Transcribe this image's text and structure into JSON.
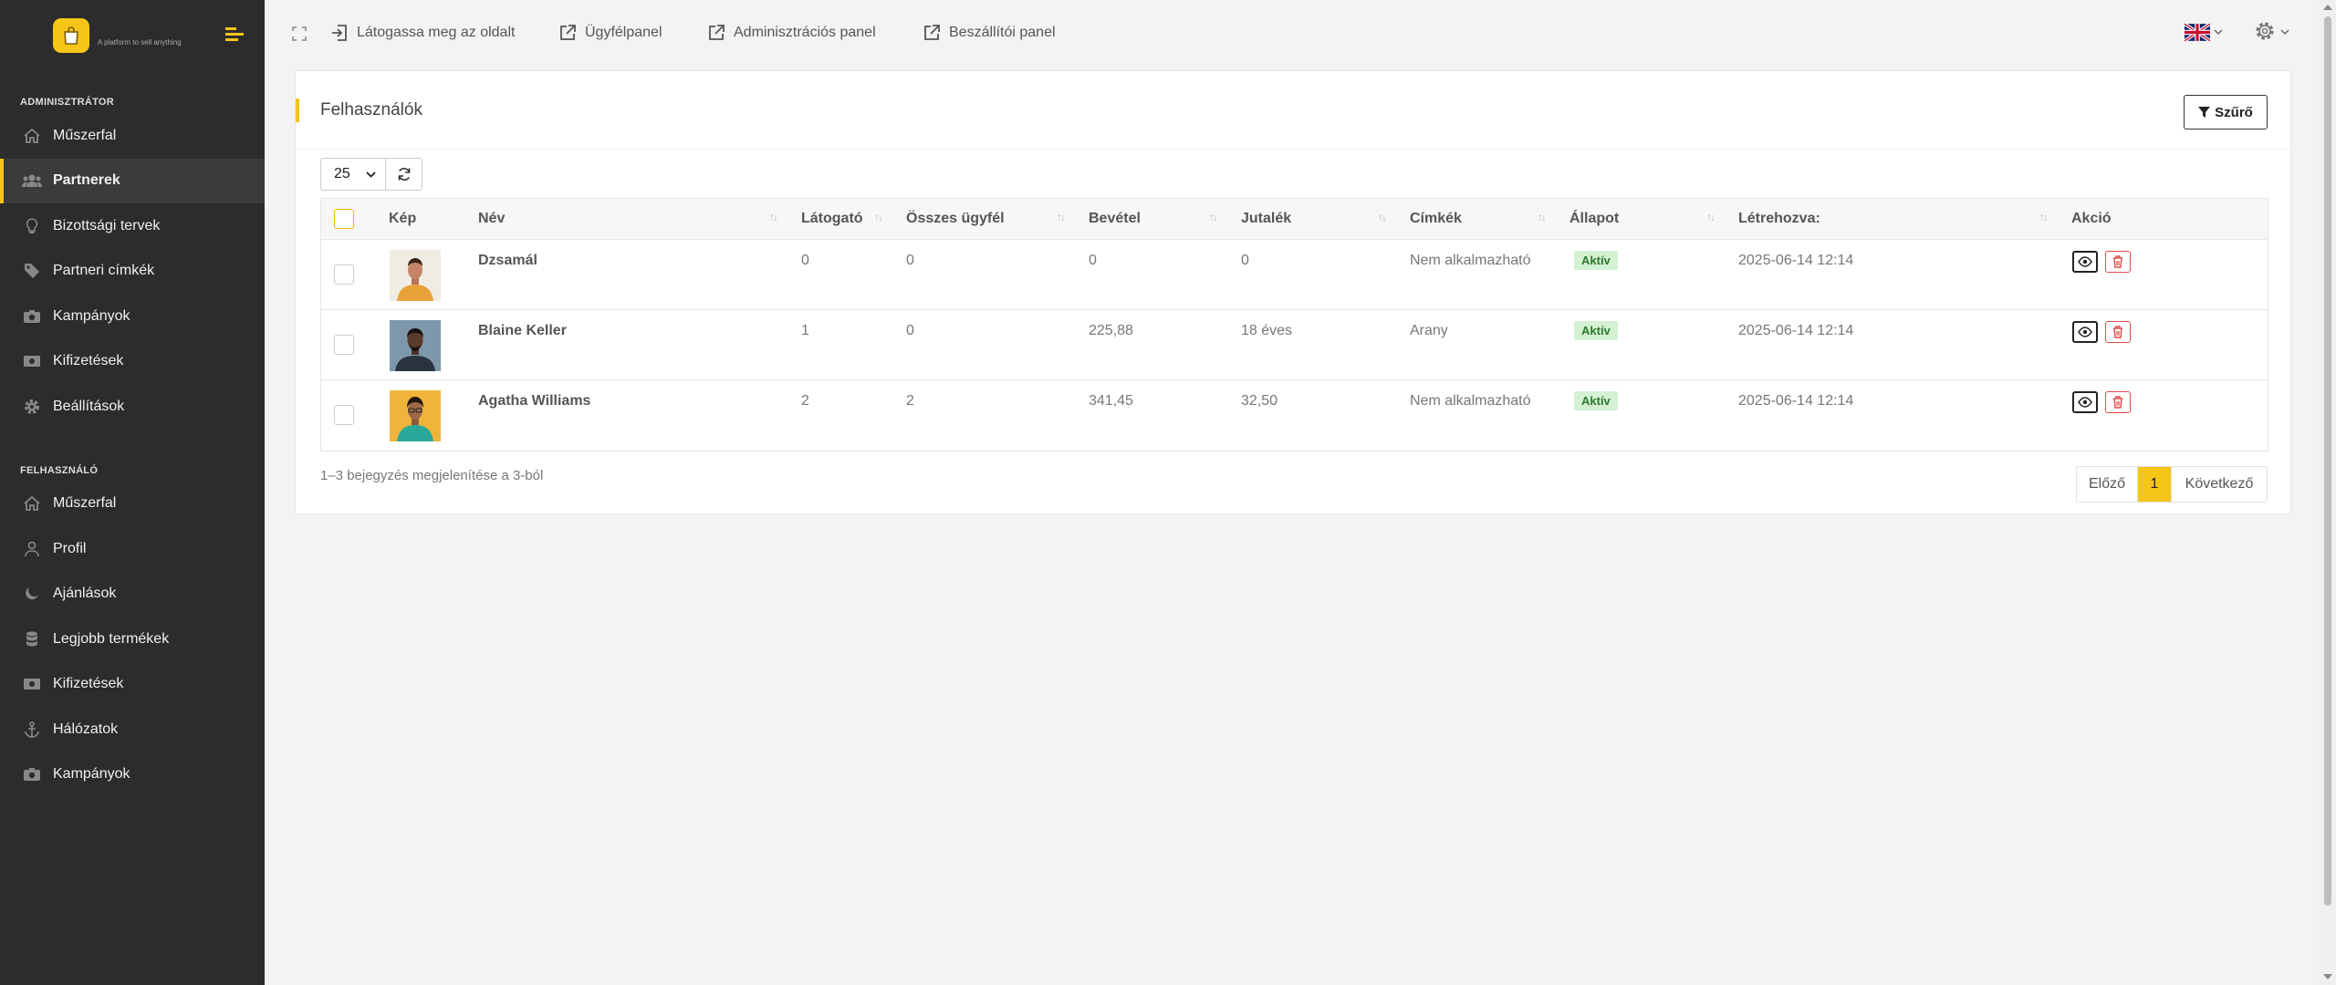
{
  "brand": {
    "tagline": "A platform to sell anything"
  },
  "sidebar": {
    "sections": [
      {
        "title": "Adminisztrátor",
        "items": [
          {
            "label": "Műszerfal",
            "icon": "home-icon"
          },
          {
            "label": "Partnerek",
            "icon": "users-icon",
            "active": true
          },
          {
            "label": "Bizottsági tervek",
            "icon": "lightbulb-icon"
          },
          {
            "label": "Partneri címkék",
            "icon": "tag-icon"
          },
          {
            "label": "Kampányok",
            "icon": "camera-icon"
          },
          {
            "label": "Kifizetések",
            "icon": "money-icon"
          },
          {
            "label": "Beállítások",
            "icon": "gear-icon"
          }
        ]
      },
      {
        "title": "Felhasználó",
        "items": [
          {
            "label": "Műszerfal",
            "icon": "home-icon"
          },
          {
            "label": "Profil",
            "icon": "user-icon"
          },
          {
            "label": "Ajánlások",
            "icon": "moon-icon"
          },
          {
            "label": "Legjobb termékek",
            "icon": "database-icon"
          },
          {
            "label": "Kifizetések",
            "icon": "money-icon"
          },
          {
            "label": "Hálózatok",
            "icon": "anchor-icon"
          },
          {
            "label": "Kampányok",
            "icon": "camera-icon"
          }
        ]
      }
    ]
  },
  "topbar": {
    "links": [
      {
        "label": "Látogassa meg az oldalt",
        "icon": "sign-in-icon"
      },
      {
        "label": "Ügyfélpanel",
        "icon": "external-link-icon"
      },
      {
        "label": "Adminisztrációs panel",
        "icon": "external-link-icon"
      },
      {
        "label": "Beszállítói panel",
        "icon": "external-link-icon"
      }
    ]
  },
  "card": {
    "title": "Felhasználók",
    "filter_label": "Szűrő",
    "page_size": "25",
    "table": {
      "columns": [
        "Kép",
        "Név",
        "Látogató",
        "Összes ügyfél",
        "Bevétel",
        "Jutalék",
        "Címkék",
        "Állapot",
        "Létrehozva:",
        "Akció"
      ],
      "rows": [
        {
          "name": "Dzsamál",
          "visitors": "0",
          "customers": "0",
          "revenue": "0",
          "commission": "0",
          "tags": "Nem alkalmazható",
          "status": "Aktív",
          "created": "2025-06-14 12:14"
        },
        {
          "name": "Blaine Keller",
          "visitors": "1",
          "customers": "0",
          "revenue": "225,88",
          "commission": "18 éves",
          "tags": "Arany",
          "status": "Aktív",
          "created": "2025-06-14 12:14"
        },
        {
          "name": "Agatha Williams",
          "visitors": "2",
          "customers": "2",
          "revenue": "341,45",
          "commission": "32,50",
          "tags": "Nem alkalmazható",
          "status": "Aktív",
          "created": "2025-06-14 12:14"
        }
      ]
    },
    "info": "1–3 bejegyzés megjelenítése a 3-ból",
    "pagination": {
      "prev": "Előző",
      "current": "1",
      "next": "Következő"
    }
  },
  "colors": {
    "accent": "#f5c518",
    "sidebar_bg": "#2c2c2c",
    "badge_bg": "#d4f1d4",
    "danger": "#e24a4a"
  }
}
